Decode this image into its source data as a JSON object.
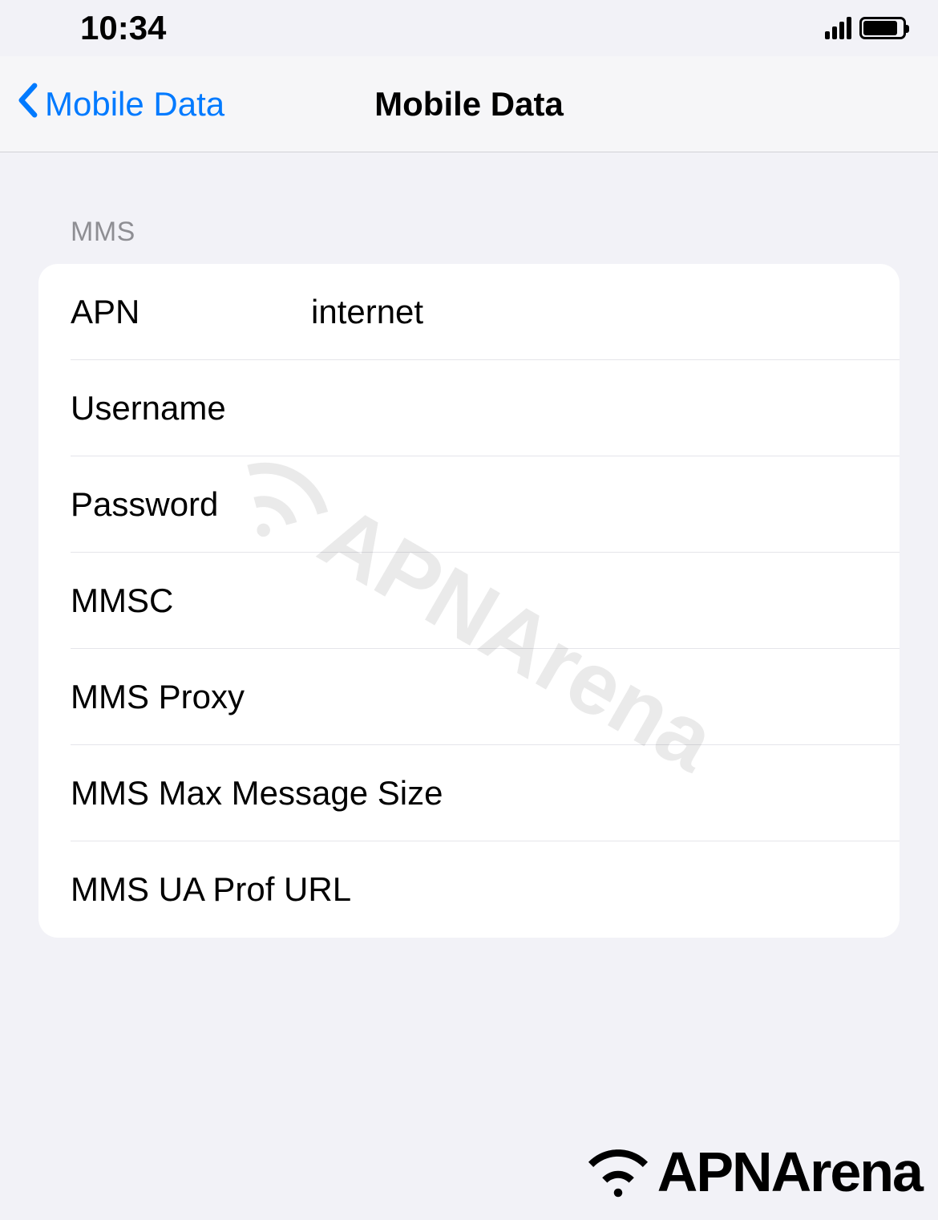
{
  "status": {
    "time": "10:34"
  },
  "nav": {
    "back_label": "Mobile Data",
    "title": "Mobile Data"
  },
  "section": {
    "header": "MMS"
  },
  "fields": {
    "apn": {
      "label": "APN",
      "value": "internet"
    },
    "username": {
      "label": "Username",
      "value": ""
    },
    "password": {
      "label": "Password",
      "value": ""
    },
    "mmsc": {
      "label": "MMSC",
      "value": ""
    },
    "mms_proxy": {
      "label": "MMS Proxy",
      "value": ""
    },
    "mms_max_size": {
      "label": "MMS Max Message Size",
      "value": ""
    },
    "mms_ua_prof_url": {
      "label": "MMS UA Prof URL",
      "value": ""
    }
  },
  "watermark": {
    "text": "APNArena"
  },
  "footer": {
    "brand": "APNArena"
  }
}
